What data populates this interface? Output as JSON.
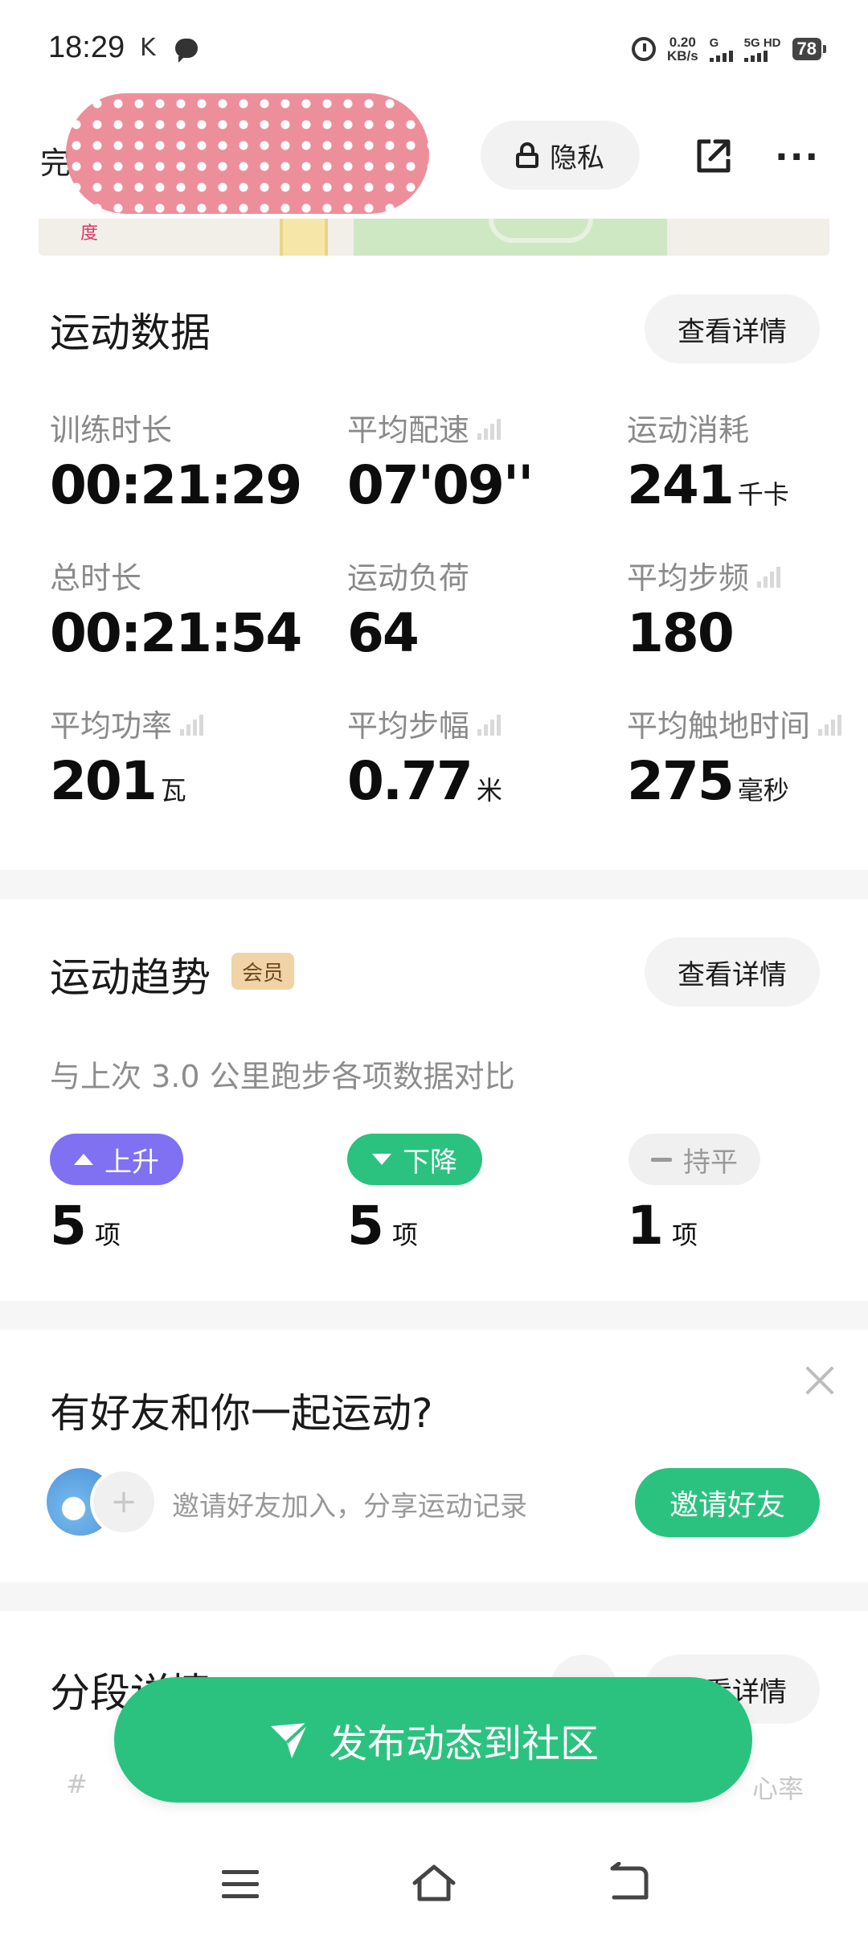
{
  "status_bar": {
    "time": "18:29",
    "k_icon": "K",
    "speed_value": "0.20",
    "speed_unit": "KB/s",
    "signal1_label": "G",
    "signal2_label": "5G HD",
    "battery": "78"
  },
  "header": {
    "title_visible_char": "完",
    "privacy_label": "隐私"
  },
  "map": {
    "label_left": "度"
  },
  "sport_data": {
    "title": "运动数据",
    "detail_button": "查看详情",
    "stats": [
      {
        "label": "训练时长",
        "value": "00:21:29",
        "unit": "",
        "trend_icon": false
      },
      {
        "label": "平均配速",
        "value": "07'09''",
        "unit": "",
        "trend_icon": true
      },
      {
        "label": "运动消耗",
        "value": "241",
        "unit": "千卡",
        "trend_icon": false
      },
      {
        "label": "总时长",
        "value": "00:21:54",
        "unit": "",
        "trend_icon": false
      },
      {
        "label": "运动负荷",
        "value": "64",
        "unit": "",
        "trend_icon": false
      },
      {
        "label": "平均步频",
        "value": "180",
        "unit": "",
        "trend_icon": true
      },
      {
        "label": "平均功率",
        "value": "201",
        "unit": "瓦",
        "trend_icon": true
      },
      {
        "label": "平均步幅",
        "value": "0.77",
        "unit": "米",
        "trend_icon": true
      },
      {
        "label": "平均触地时间",
        "value": "275",
        "unit": "毫秒",
        "trend_icon": true
      }
    ]
  },
  "trend": {
    "title": "运动趋势",
    "badge": "会员",
    "detail_button": "查看详情",
    "subtitle": "与上次 3.0 公里跑步各项数据对比",
    "up": {
      "label": "上升",
      "count": "5",
      "unit": "项"
    },
    "down": {
      "label": "下降",
      "count": "5",
      "unit": "项"
    },
    "flat": {
      "label": "持平",
      "count": "1",
      "unit": "项"
    }
  },
  "friends": {
    "title": "有好友和你一起运动?",
    "invite_text": "邀请好友加入，分享运动记录",
    "invite_button": "邀请好友",
    "plus": "+"
  },
  "segment": {
    "title": "分段详情",
    "detail_button": "查看详情",
    "col_hash": "#",
    "col_hr": "心率"
  },
  "publish": {
    "label": "发布动态到社区"
  },
  "colors": {
    "accent_green": "#2bc280",
    "up_purple": "#8070f2",
    "member_gold": "#f0d3a6"
  }
}
